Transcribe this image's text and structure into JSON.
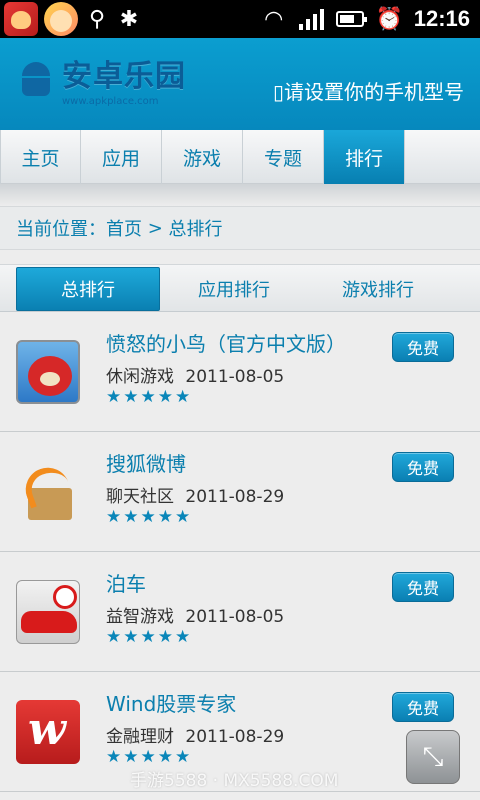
{
  "statusbar": {
    "time": "12:16",
    "battery_level": 0.6,
    "icons": [
      "notification-app-icon",
      "notification-app-icon",
      "usb-icon",
      "android-debug-icon",
      "wifi-icon",
      "signal-icon",
      "battery-icon",
      "alarm-icon"
    ]
  },
  "header": {
    "logo_title": "安卓乐园",
    "logo_sub": "www.apkplace.com",
    "set_phone": "请设置你的手机型号"
  },
  "nav": {
    "items": [
      "主页",
      "应用",
      "游戏",
      "专题",
      "排行"
    ],
    "active": "排行"
  },
  "breadcrumb": {
    "prefix": "当前位置：",
    "home": "首页",
    "separator": " > ",
    "current": "总排行"
  },
  "subtabs": {
    "items": [
      "总排行",
      "应用排行",
      "游戏排行"
    ],
    "active": "总排行"
  },
  "apps": [
    {
      "name": "愤怒的小鸟（官方中文版）",
      "category": "休闲游戏",
      "date": "2011-08-05",
      "rating": 5,
      "button": "免费",
      "icon": "angry-birds-icon"
    },
    {
      "name": "搜狐微博",
      "category": "聊天社区",
      "date": "2011-08-29",
      "rating": 5,
      "button": "免费",
      "icon": "sohu-weibo-icon"
    },
    {
      "name": "泊车",
      "category": "益智游戏",
      "date": "2011-08-05",
      "rating": 5,
      "button": "免费",
      "icon": "parking-car-icon"
    },
    {
      "name": "Wind股票专家",
      "category": "金融理财",
      "date": "2011-08-29",
      "rating": 5,
      "button": "免费",
      "icon": "wind-stock-icon"
    }
  ],
  "watermark": "手游5588 · MX5588.COM",
  "colors": {
    "accent": "#0b7fae",
    "header_blue": "#0b9ed0",
    "active_tab": "#077fb1"
  }
}
